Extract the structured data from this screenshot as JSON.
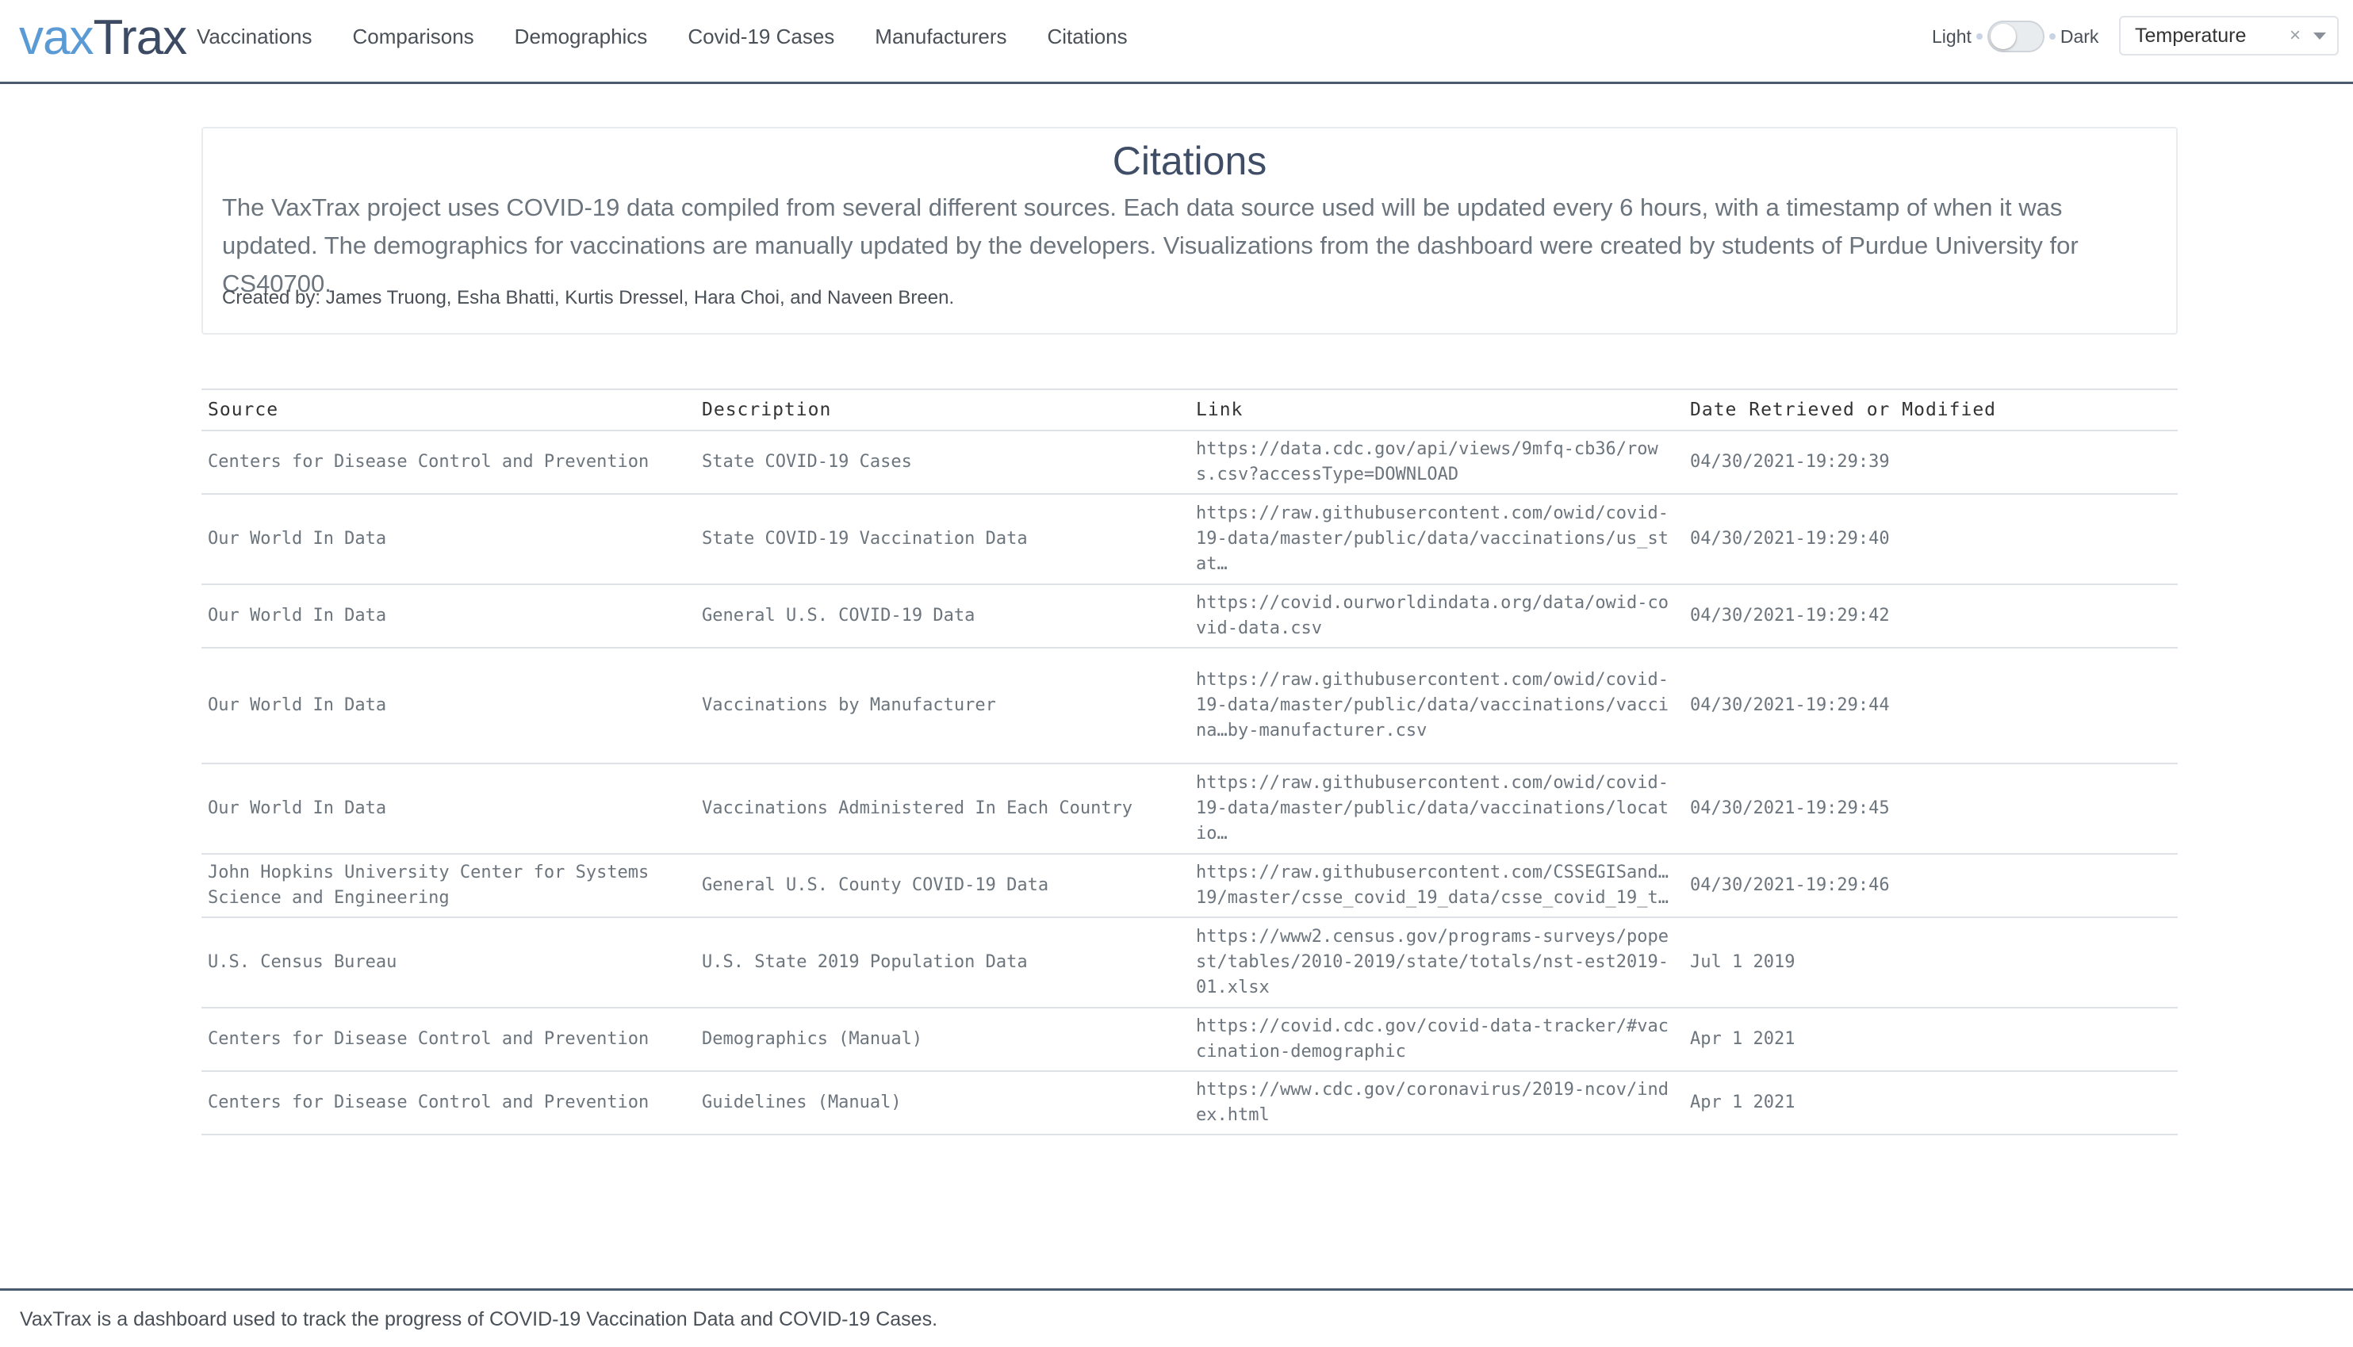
{
  "brand": {
    "part1": "vax",
    "part2": "Trax"
  },
  "nav": {
    "links": [
      "Vaccinations",
      "Comparisons",
      "Demographics",
      "Covid-19 Cases",
      "Manufacturers",
      "Citations"
    ]
  },
  "theme": {
    "light_label": "Light",
    "dark_label": "Dark",
    "dark_enabled": false
  },
  "select": {
    "value": "Temperature",
    "clear_icon": "×"
  },
  "card": {
    "title": "Citations",
    "lead": "The VaxTrax project uses COVID-19 data compiled from several different sources. Each data source used will be updated every 6 hours, with a timestamp of when it was updated. The demographics for vaccinations are manually updated by the developers. Visualizations from the dashboard were created by students of Purdue University for CS40700.",
    "credit": "Created by: James Truong, Esha Bhatti, Kurtis Dressel, Hara Choi, and Naveen Breen."
  },
  "table": {
    "headers": [
      "Source",
      "Description",
      "Link",
      "Date Retrieved or Modified"
    ],
    "rows": [
      {
        "source": "Centers for Disease Control and Prevention",
        "description": "State COVID-19 Cases",
        "link": "https://data.cdc.gov/api/views/9mfq-cb36/rows.csv?accessType=DOWNLOAD",
        "date": "04/30/2021-19:29:39"
      },
      {
        "source": "Our World In Data",
        "description": "State COVID-19 Vaccination Data",
        "link": "https://raw.githubusercontent.com/owid/covid-19-data/master/public/data/vaccinations/us_stat…",
        "date": "04/30/2021-19:29:40"
      },
      {
        "source": "Our World In Data",
        "description": "General U.S. COVID-19 Data",
        "link": "https://covid.ourworldindata.org/data/owid-covid-data.csv",
        "date": "04/30/2021-19:29:42"
      },
      {
        "source": "Our World In Data",
        "description": "Vaccinations by Manufacturer",
        "link": "https://raw.githubusercontent.com/owid/covid-19-data/master/public/data/vaccinations/vaccina…by-manufacturer.csv",
        "date": "04/30/2021-19:29:44"
      },
      {
        "source": "Our World In Data",
        "description": "Vaccinations Administered In Each Country",
        "link": "https://raw.githubusercontent.com/owid/covid-19-data/master/public/data/vaccinations/locatio…",
        "date": "04/30/2021-19:29:45"
      },
      {
        "source": "John Hopkins University Center for Systems Science and Engineering",
        "description": "General U.S. County COVID-19 Data",
        "link": "https://raw.githubusercontent.com/CSSEGISand…19/master/csse_covid_19_data/csse_covid_19_t…",
        "date": "04/30/2021-19:29:46"
      },
      {
        "source": "U.S. Census Bureau",
        "description": "U.S. State 2019 Population Data",
        "link": "https://www2.census.gov/programs-surveys/popest/tables/2010-2019/state/totals/nst-est2019-01.xlsx",
        "date": "Jul 1 2019"
      },
      {
        "source": "Centers for Disease Control and Prevention",
        "description": "Demographics (Manual)",
        "link": "https://covid.cdc.gov/covid-data-tracker/#vaccination-demographic",
        "date": "Apr 1 2021"
      },
      {
        "source": "Centers for Disease Control and Prevention",
        "description": "Guidelines (Manual)",
        "link": "https://www.cdc.gov/coronavirus/2019-ncov/index.html",
        "date": "Apr 1 2021"
      }
    ]
  },
  "footer": {
    "text": "VaxTrax is a dashboard used to track the progress of COVID-19 Vaccination Data and COVID-19 Cases."
  }
}
